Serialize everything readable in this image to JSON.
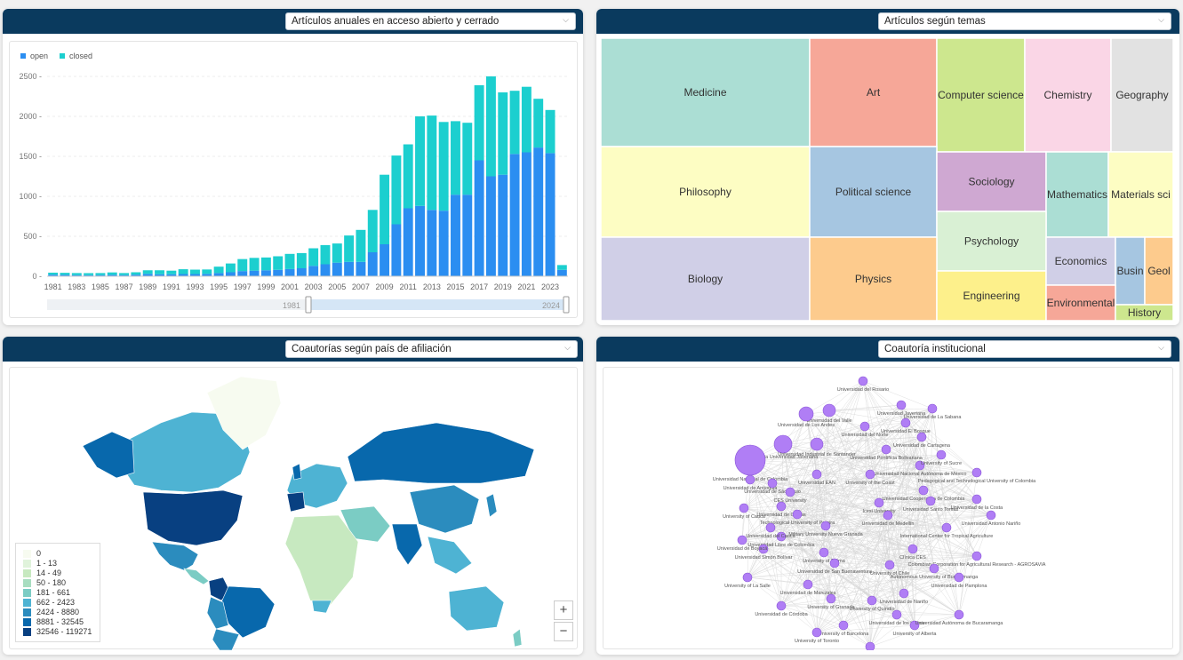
{
  "panels": {
    "annual": {
      "dropdown": "Artículos anuales en acceso abierto y cerrado"
    },
    "topics": {
      "dropdown": "Artículos según temas"
    },
    "map": {
      "dropdown": "Coautorías según país de afiliación"
    },
    "network": {
      "dropdown": "Coautoría institucional"
    }
  },
  "colors": {
    "header": "#0a3a5e",
    "open": "#2b8ef1",
    "closed": "#1ccfcf",
    "node": "#b07ef5"
  },
  "chart_data": {
    "type": "bar",
    "stacked": true,
    "legend": [
      "open",
      "closed"
    ],
    "x": [
      1981,
      1982,
      1983,
      1984,
      1985,
      1986,
      1987,
      1988,
      1989,
      1990,
      1991,
      1992,
      1993,
      1994,
      1995,
      1996,
      1997,
      1998,
      1999,
      2000,
      2001,
      2002,
      2003,
      2004,
      2005,
      2006,
      2007,
      2008,
      2009,
      2010,
      2011,
      2012,
      2013,
      2014,
      2015,
      2016,
      2017,
      2018,
      2019,
      2020,
      2021,
      2022,
      2023,
      2024
    ],
    "xticks": [
      "1981",
      "1983",
      "1985",
      "1987",
      "1989",
      "1991",
      "1993",
      "1995",
      "1997",
      "1999",
      "2001",
      "2003",
      "2005",
      "2007",
      "2009",
      "2011",
      "2013",
      "2015",
      "2017",
      "2019",
      "2021",
      "2023"
    ],
    "series": [
      {
        "name": "open",
        "values": [
          20,
          18,
          15,
          14,
          15,
          18,
          15,
          20,
          30,
          25,
          25,
          28,
          28,
          30,
          40,
          50,
          65,
          70,
          75,
          80,
          90,
          100,
          130,
          150,
          170,
          180,
          180,
          300,
          400,
          650,
          850,
          880,
          830,
          820,
          1020,
          1020,
          1450,
          1250,
          1270,
          1530,
          1550,
          1610,
          1540,
          80
        ]
      },
      {
        "name": "closed",
        "values": [
          25,
          25,
          25,
          25,
          25,
          30,
          25,
          30,
          45,
          50,
          45,
          60,
          55,
          55,
          80,
          110,
          150,
          160,
          160,
          170,
          190,
          190,
          220,
          240,
          240,
          330,
          400,
          530,
          870,
          860,
          800,
          1120,
          1180,
          1110,
          920,
          900,
          940,
          1250,
          1030,
          790,
          820,
          610,
          540,
          60
        ]
      }
    ],
    "ylim": [
      0,
      2600
    ],
    "yticks": [
      "0",
      "500",
      "1000",
      "1500",
      "2000",
      "2500"
    ],
    "slider": {
      "min": "1981",
      "max": "2024"
    }
  },
  "treemap": [
    {
      "label": "Medicine",
      "color": "#abded4"
    },
    {
      "label": "Art",
      "color": "#f6a798"
    },
    {
      "label": "Computer science",
      "color": "#cde78e"
    },
    {
      "label": "Chemistry",
      "color": "#fad6e6"
    },
    {
      "label": "Geography",
      "color": "#e2e2e2"
    },
    {
      "label": "Philosophy",
      "color": "#fdfdc3"
    },
    {
      "label": "Political science",
      "color": "#a6c6e1"
    },
    {
      "label": "Sociology",
      "color": "#cfa8d2"
    },
    {
      "label": "Mathematics",
      "color": "#abded4"
    },
    {
      "label": "Materials sci",
      "color": "#fdfdc3"
    },
    {
      "label": "Psychology",
      "color": "#d9f0d4"
    },
    {
      "label": "Biology",
      "color": "#d0cfe7"
    },
    {
      "label": "Physics",
      "color": "#fdcb8d"
    },
    {
      "label": "Engineering",
      "color": "#fdf08b"
    },
    {
      "label": "Economics",
      "color": "#d0cfe7"
    },
    {
      "label": "Busin",
      "color": "#a6c6e1"
    },
    {
      "label": "Geol",
      "color": "#fdcb8d"
    },
    {
      "label": "Environmental",
      "color": "#f6a798"
    },
    {
      "label": "History",
      "color": "#cde78e"
    }
  ],
  "map_legend": [
    {
      "label": "0",
      "color": "#f7fbf0"
    },
    {
      "label": "1 - 13",
      "color": "#e0f3db"
    },
    {
      "label": "14 - 49",
      "color": "#c7e9c0"
    },
    {
      "label": "50 - 180",
      "color": "#a8ddc0"
    },
    {
      "label": "181 - 661",
      "color": "#7bccc4"
    },
    {
      "label": "662 - 2423",
      "color": "#4eb3d3"
    },
    {
      "label": "2424 - 8880",
      "color": "#2b8cbe"
    },
    {
      "label": "8881 - 32545",
      "color": "#0868ac"
    },
    {
      "label": "32546 - 119271",
      "color": "#084081"
    }
  ],
  "map_zoom": {
    "in": "+",
    "out": "−"
  },
  "network_nodes": [
    "Universidad del Rosario",
    "Universidad de La Sabana",
    "Universidad del Valle",
    "Universidad Javeriana",
    "Universidad de Los Andes",
    "Universidad del Norte",
    "Universidad El Bosque",
    "Universidad de Cartagena",
    "Pontificia Universidad Javeriana",
    "Universidad Nacional de Colombia",
    "Universidad de Antioquia",
    "Universidad Pontificia Bolivariana",
    "Universidad Nacional Autónoma de México",
    "Pedagogical and Technological University of Colombia",
    "Universidad Industrial de Santander",
    "University of the Coast",
    "Universidad Cooperativa de Colombia",
    "Universidad de São Paulo",
    "University of Cauca",
    "Universidad de Caldas",
    "Universidad Santo Tomás",
    "Icesi University",
    "Technological University of Pereira",
    "Universidad de Medellín",
    "Universidad Antonio Nariño",
    "Military University Nueva Granada",
    "International Center for Tropical Agriculture",
    "Universidad Libre de Colombia",
    "Universidad Simón Bolívar",
    "Clínica CES",
    "University of Tolima",
    "Colombian Corporation for Agricultural Research - AGROSAVIA",
    "Universidad de San Buenaventura",
    "University of Chile",
    "Autonomous University of Bucaramanga",
    "University of La Salle",
    "Universidad de Manizales",
    "Universidad de Córdoba",
    "University of Quindío",
    "Universidad de Nariño",
    "Universidad de los Llanos",
    "University of Barcelona",
    "University of Toronto",
    "University of Alberta",
    "Universidad Autónoma de Bucaramanga",
    "University of Buenos Aires",
    "Universidad de Boyacá",
    "Universidad del Cauca",
    "Universidad de la Costa",
    "University of Sucre",
    "Universidad EAN",
    "CES University",
    "Universidad de Pamplona",
    "University of Granada"
  ]
}
